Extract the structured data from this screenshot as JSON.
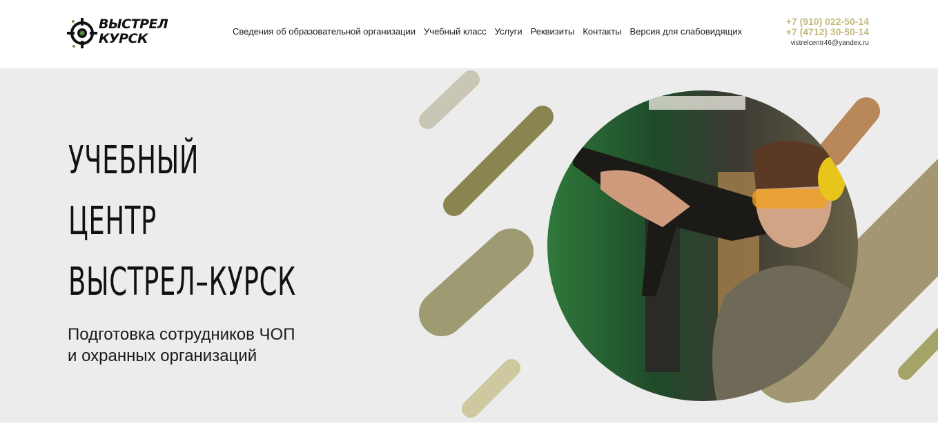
{
  "header": {
    "logo": {
      "line1": "ВЫСТРЕЛ",
      "line2": "КУРСК",
      "icon": "target-crosshair-icon"
    },
    "nav": [
      {
        "label": "Сведения об образовательной организации"
      },
      {
        "label": "Учебный класс"
      },
      {
        "label": "Услуги"
      },
      {
        "label": "Реквизиты"
      },
      {
        "label": "Контакты"
      },
      {
        "label": "Версия для слабовидящих"
      }
    ],
    "contacts": {
      "phone1": "+7 (910) 022-50-14",
      "phone2": "+7 (4712) 30-50-14",
      "email": "vistrelcentr46@yandex.ru"
    }
  },
  "hero": {
    "title": [
      "УЧЕБНЫЙ",
      "ЦЕНТР",
      "ВЫСТРЕЛ–КУРСК"
    ],
    "subtitle": [
      "Подготовка сотрудников ЧОП",
      "и охранных организаций"
    ],
    "image": "woman-shooting-rifle-photo"
  },
  "colors": {
    "accent": "#c4b97e",
    "olive_dark": "#8a8550",
    "olive_mid": "#9e9a71",
    "khaki": "#a39672",
    "stripe_light": "#cac6b5",
    "pale": "#cdc89d",
    "brown": "#b8875a",
    "green": "#a4a466",
    "hero_bg": "#ececec"
  }
}
